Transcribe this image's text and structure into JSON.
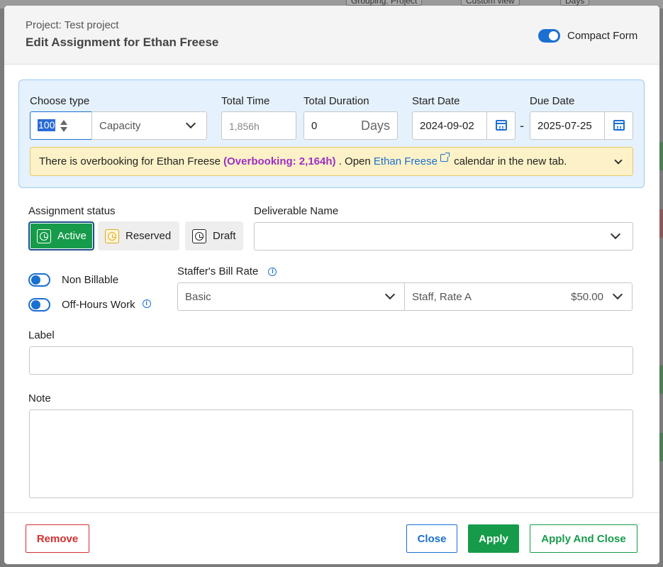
{
  "background": {
    "toolbar_items": [
      "Grouping: Project",
      "Custom view",
      "Days"
    ]
  },
  "header": {
    "project_line": "Project: Test project",
    "title": "Edit Assignment for Ethan Freese",
    "compact_form_label": "Compact Form",
    "compact_form_on": true
  },
  "type_panel": {
    "choose_type_label": "Choose type",
    "percent_value": "100",
    "type_value": "Capacity",
    "total_time_label": "Total Time",
    "total_time_placeholder": "1,856h",
    "total_duration_label": "Total Duration",
    "total_duration_value": "0",
    "total_duration_unit": "Days",
    "start_date_label": "Start Date",
    "start_date_value": "2024-09-02",
    "date_separator": "-",
    "due_date_label": "Due Date",
    "due_date_value": "2025-07-25"
  },
  "alert": {
    "prefix": "There is overbooking for Ethan Freese",
    "overbooking": "(Overbooking: 2,164h)",
    "open_text": ". Open",
    "link_text": "Ethan Freese",
    "suffix": "calendar in the new tab."
  },
  "assignment_status": {
    "label": "Assignment status",
    "options": [
      "Active",
      "Reserved",
      "Draft"
    ],
    "selected": "Active"
  },
  "deliverable": {
    "label": "Deliverable Name",
    "value": ""
  },
  "toggles": {
    "non_billable": "Non Billable",
    "off_hours": "Off-Hours Work"
  },
  "bill_rate": {
    "label": "Staffer's Bill Rate",
    "rate_type": "Basic",
    "rate_name": "Staff, Rate A",
    "rate_amount": "$50.00"
  },
  "label_field": {
    "label": "Label",
    "value": ""
  },
  "note_field": {
    "label": "Note",
    "value": ""
  },
  "footer": {
    "remove": "Remove",
    "close": "Close",
    "apply": "Apply",
    "apply_and_close": "Apply And Close"
  },
  "colors": {
    "primary_blue": "#1b6fd1",
    "success_green": "#169b4a",
    "danger_red": "#d32f2f",
    "overbooking_purple": "#9b2fc4",
    "alert_bg": "#fdf2c7",
    "panel_bg": "#e5f1fc"
  }
}
